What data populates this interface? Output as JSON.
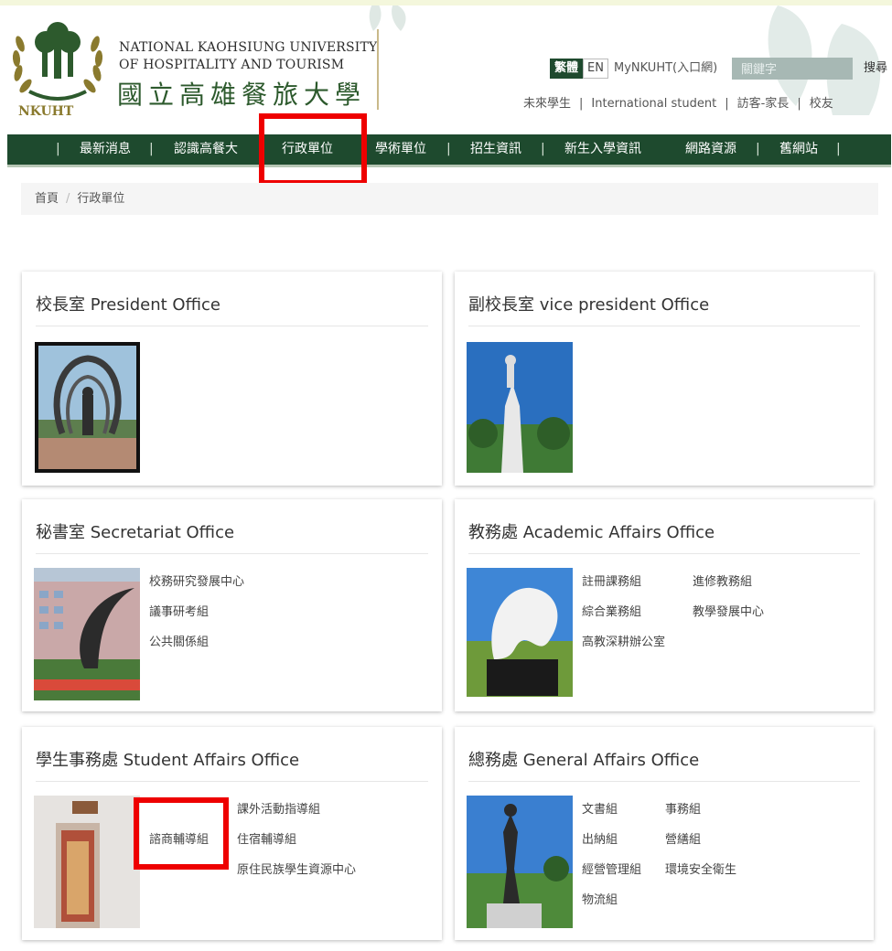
{
  "header": {
    "logo_text": "NKUHT",
    "university_en_line1": "NATIONAL KAOHSIUNG UNIVERSITY",
    "university_en_line2": "OF HOSPITALITY AND TOURISM",
    "university_zh": "國立高雄餐旅大學",
    "lang_zh": "繁體",
    "lang_en": "EN",
    "portal_link": "MyNKUHT(入口網)",
    "search_placeholder": "關鍵字",
    "search_button": "搜尋",
    "sublinks": [
      "未來學生",
      "International student",
      "訪客-家長",
      "校友"
    ],
    "sublink_separator": "|"
  },
  "nav": {
    "separator": "|",
    "items": [
      "最新消息",
      "認識高餐大",
      "行政單位",
      "學術單位",
      "招生資訊",
      "新生入學資訊",
      "網路資源",
      "舊網站"
    ]
  },
  "breadcrumb": {
    "home": "首頁",
    "separator": "/",
    "current": "行政單位"
  },
  "cards": [
    {
      "title": "校長室 President Office",
      "links": []
    },
    {
      "title": "副校長室 vice president Office",
      "links": []
    },
    {
      "title": "秘書室 Secretariat Office",
      "links": [
        "校務研究發展中心",
        "議事研考組",
        "公共關係組"
      ]
    },
    {
      "title": "教務處 Academic Affairs Office",
      "links": [
        "註冊課務組",
        "進修教務組",
        "綜合業務組",
        "教學發展中心",
        "高教深耕辦公室"
      ]
    },
    {
      "title": "學生事務處 Student Affairs Office",
      "links": [
        "課外活動指導組",
        "諮商輔導組",
        "住宿輔導組",
        "原住民族學生資源中心"
      ]
    },
    {
      "title": "總務處 General Affairs Office",
      "links": [
        "文書組",
        "事務組",
        "出納組",
        "營繕組",
        "經營管理組",
        "環境安全衛生",
        "物流組"
      ]
    }
  ],
  "colors": {
    "nav_green": "#1e4a2e",
    "highlight_red": "#ee0000",
    "search_bg": "#a7b8b4"
  }
}
